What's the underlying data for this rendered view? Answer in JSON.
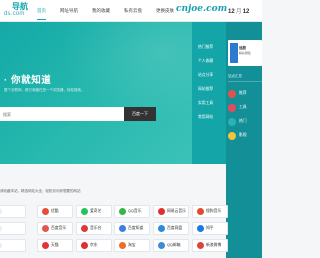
{
  "logo": {
    "top": "导航",
    "sub": "ds.com"
  },
  "nav": [
    "首页",
    "网址导航",
    "我的收藏",
    "私有云盘",
    "更换皮肤"
  ],
  "domain": "cnjoe.com",
  "date": {
    "month": "12",
    "sep": "月",
    "day": "12"
  },
  "hero": {
    "title": "· 你就知道",
    "subtitle": "整个互联网，都已收藏在您一个浏览器，轻松搜索。",
    "search_placeholder": "搜索",
    "search_button": "百度一下"
  },
  "side_links": [
    "热门推荐",
    "个人收藏",
    "站点分享",
    "网站推荐",
    "实用工具",
    "常用网站"
  ],
  "right_card": {
    "title": "追剧",
    "subtitle": "精彩剧集"
  },
  "right_panel": {
    "header": "站点汇总",
    "items": [
      {
        "label": "推荐",
        "color": "#e2524a"
      },
      {
        "label": "工具",
        "color": "#e44b5c"
      },
      {
        "label": "热门",
        "color": "#28b3b6"
      },
      {
        "label": "影视",
        "color": "#f2c33b"
      }
    ]
  },
  "notice": "请收藏本站，精选网站大全，轻松访问你想要的网站",
  "grid": [
    [
      {
        "label": "",
        "color": "#e8eef3"
      },
      {
        "label": "优酷",
        "color": "#e94b3c"
      },
      {
        "label": "爱奇艺",
        "color": "#22c35e"
      },
      {
        "label": "QQ音乐",
        "color": "#31b74b"
      },
      {
        "label": "网易云音乐",
        "color": "#e52d2d"
      },
      {
        "label": "搜狗音乐",
        "color": "#e24a2c"
      }
    ],
    [
      {
        "label": "",
        "color": "#e8eef3"
      },
      {
        "label": "百度音乐",
        "color": "#e2574c"
      },
      {
        "label": "音乐台",
        "color": "#d93b3b"
      },
      {
        "label": "百度知道",
        "color": "#3b7fe0"
      },
      {
        "label": "百度网盘",
        "color": "#2a8ce0"
      },
      {
        "label": "知乎",
        "color": "#1b78e4"
      }
    ],
    [
      {
        "label": "",
        "color": "#e8eef3"
      },
      {
        "label": "天猫",
        "color": "#e53333"
      },
      {
        "label": "京东",
        "color": "#e22e2e"
      },
      {
        "label": "淘宝",
        "color": "#f06a28"
      },
      {
        "label": "QQ邮箱",
        "color": "#3c8bd9"
      },
      {
        "label": "新浪微博",
        "color": "#e0433b"
      }
    ]
  ]
}
